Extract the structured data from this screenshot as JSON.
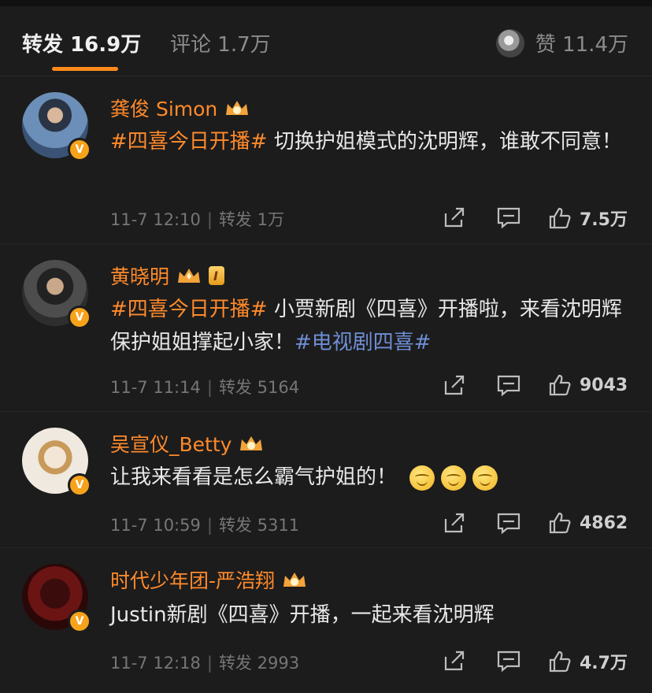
{
  "tabs": {
    "repost_label": "转发",
    "repost_count": "16.9万",
    "comment_label": "评论",
    "comment_count": "1.7万",
    "like_label": "赞",
    "like_count": "11.4万"
  },
  "posts": [
    {
      "name": "龚俊 Simon",
      "text_tag": "#四喜今日开播#",
      "text_body": " 切换护姐模式的沈明辉，谁敢不同意！",
      "time": "11-7 12:10",
      "repost_text": "转发 1万",
      "like_count": "7.5万"
    },
    {
      "name": "黄晓明",
      "badge": "I",
      "text_tag": "#四喜今日开播#",
      "text_body": " 小贾新剧《四喜》开播啦，来看沈明辉保护姐姐撑起小家！",
      "text_tag2": "#电视剧四喜#",
      "time": "11-7 11:14",
      "repost_text": "转发 5164",
      "like_count": "9043"
    },
    {
      "name": "吴宣仪_Betty",
      "text_body": "让我来看看是怎么霸气护姐的！",
      "time": "11-7 10:59",
      "repost_text": "转发 5311",
      "like_count": "4862"
    },
    {
      "name": "时代少年团-严浩翔",
      "text_body": "Justin新剧《四喜》开播，一起来看沈明辉",
      "time": "11-7 12:18",
      "repost_text": "转发 2993",
      "like_count": "4.7万"
    }
  ],
  "colors": {
    "accent": "#ff8a2b",
    "link": "#6f8ed6",
    "bg": "#1c1c1c"
  }
}
